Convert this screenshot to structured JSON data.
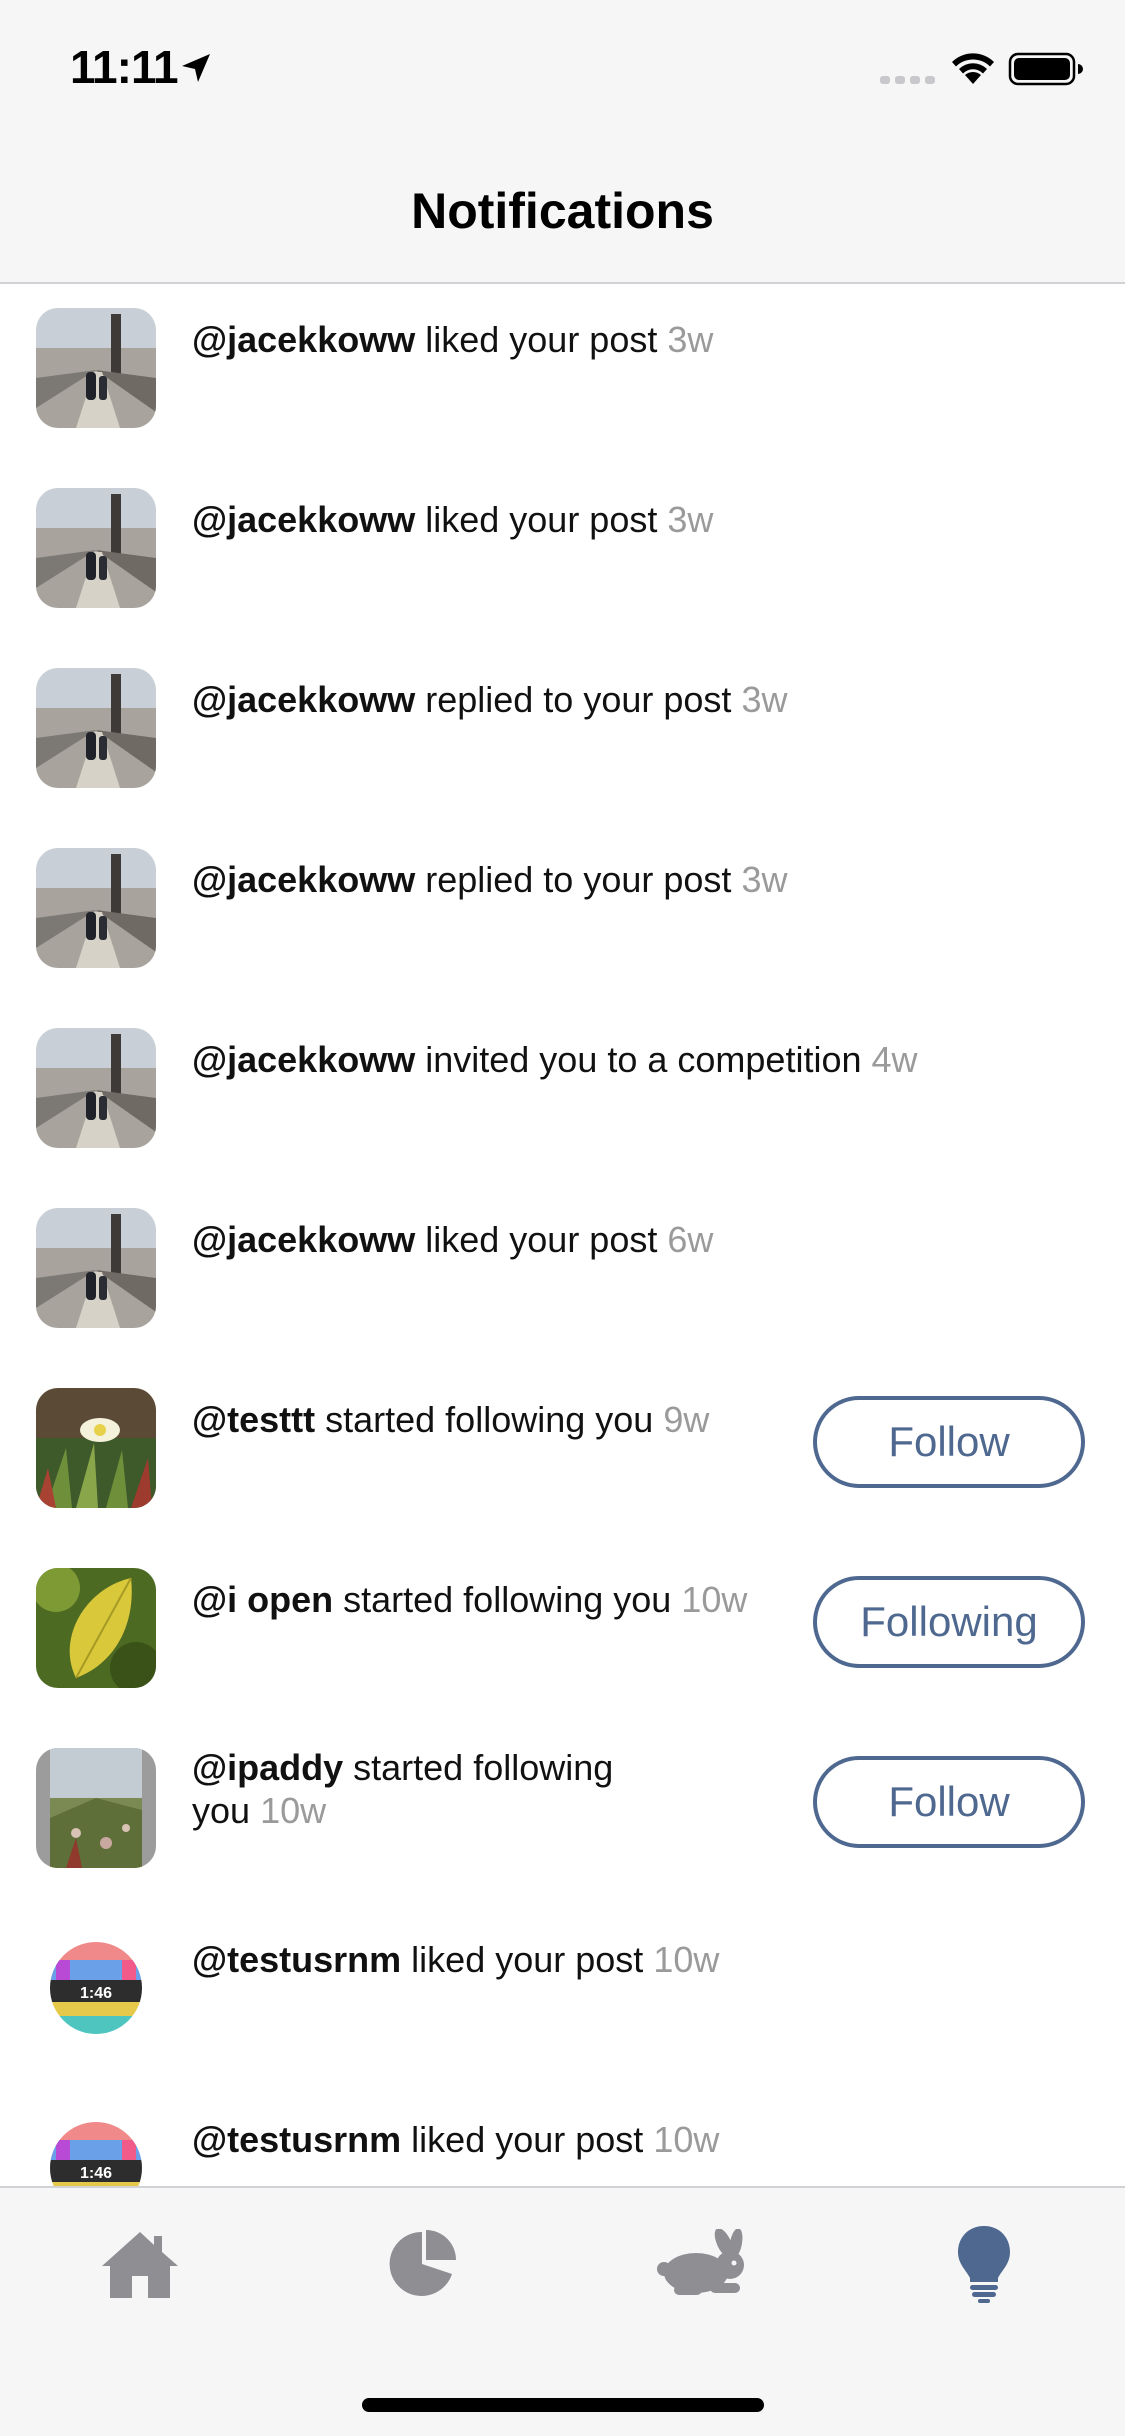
{
  "status_bar": {
    "time": "11:11"
  },
  "header": {
    "title": "Notifications"
  },
  "notifications": [
    {
      "handle": "@jacekkoww",
      "action": "liked your post",
      "time": "3w",
      "avatar": "bridge-photo"
    },
    {
      "handle": "@jacekkoww",
      "action": "liked your post",
      "time": "3w",
      "avatar": "bridge-photo"
    },
    {
      "handle": "@jacekkoww",
      "action": "replied to your post",
      "time": "3w",
      "avatar": "bridge-photo"
    },
    {
      "handle": "@jacekkoww",
      "action": "replied to your post",
      "time": "3w",
      "avatar": "bridge-photo"
    },
    {
      "handle": "@jacekkoww",
      "action": "invited you to a competition",
      "time": "4w",
      "avatar": "bridge-photo"
    },
    {
      "handle": "@jacekkoww",
      "action": "liked your post",
      "time": "6w",
      "avatar": "bridge-photo"
    },
    {
      "handle": "@testtt",
      "action": "started following you",
      "time": "9w",
      "avatar": "flower-photo",
      "button": "Follow"
    },
    {
      "handle": "@i open",
      "action": "started following you",
      "time": "10w",
      "avatar": "leaf-photo",
      "button": "Following"
    },
    {
      "handle": "@ipaddy",
      "action": "started following",
      "action_line2": "you",
      "time": "10w",
      "avatar": "succulent-photo",
      "button": "Follow"
    },
    {
      "handle": "@testusrnm",
      "action": "liked your post",
      "time": "10w",
      "avatar": "test-pattern",
      "avatar_text": "1:46"
    },
    {
      "handle": "@testusrnm",
      "action": "liked your post",
      "time": "10w",
      "avatar": "test-pattern",
      "avatar_text": "1:46"
    }
  ],
  "tabbar": {
    "items": [
      {
        "icon": "home-icon",
        "active": false
      },
      {
        "icon": "pie-chart-icon",
        "active": false
      },
      {
        "icon": "rabbit-icon",
        "active": false
      },
      {
        "icon": "lightbulb-icon",
        "active": true
      }
    ],
    "colors": {
      "inactive": "#8e8e93",
      "active": "#4e6890"
    }
  },
  "colors": {
    "accent": "#4e6890",
    "timestamp": "#9a9a9a"
  }
}
